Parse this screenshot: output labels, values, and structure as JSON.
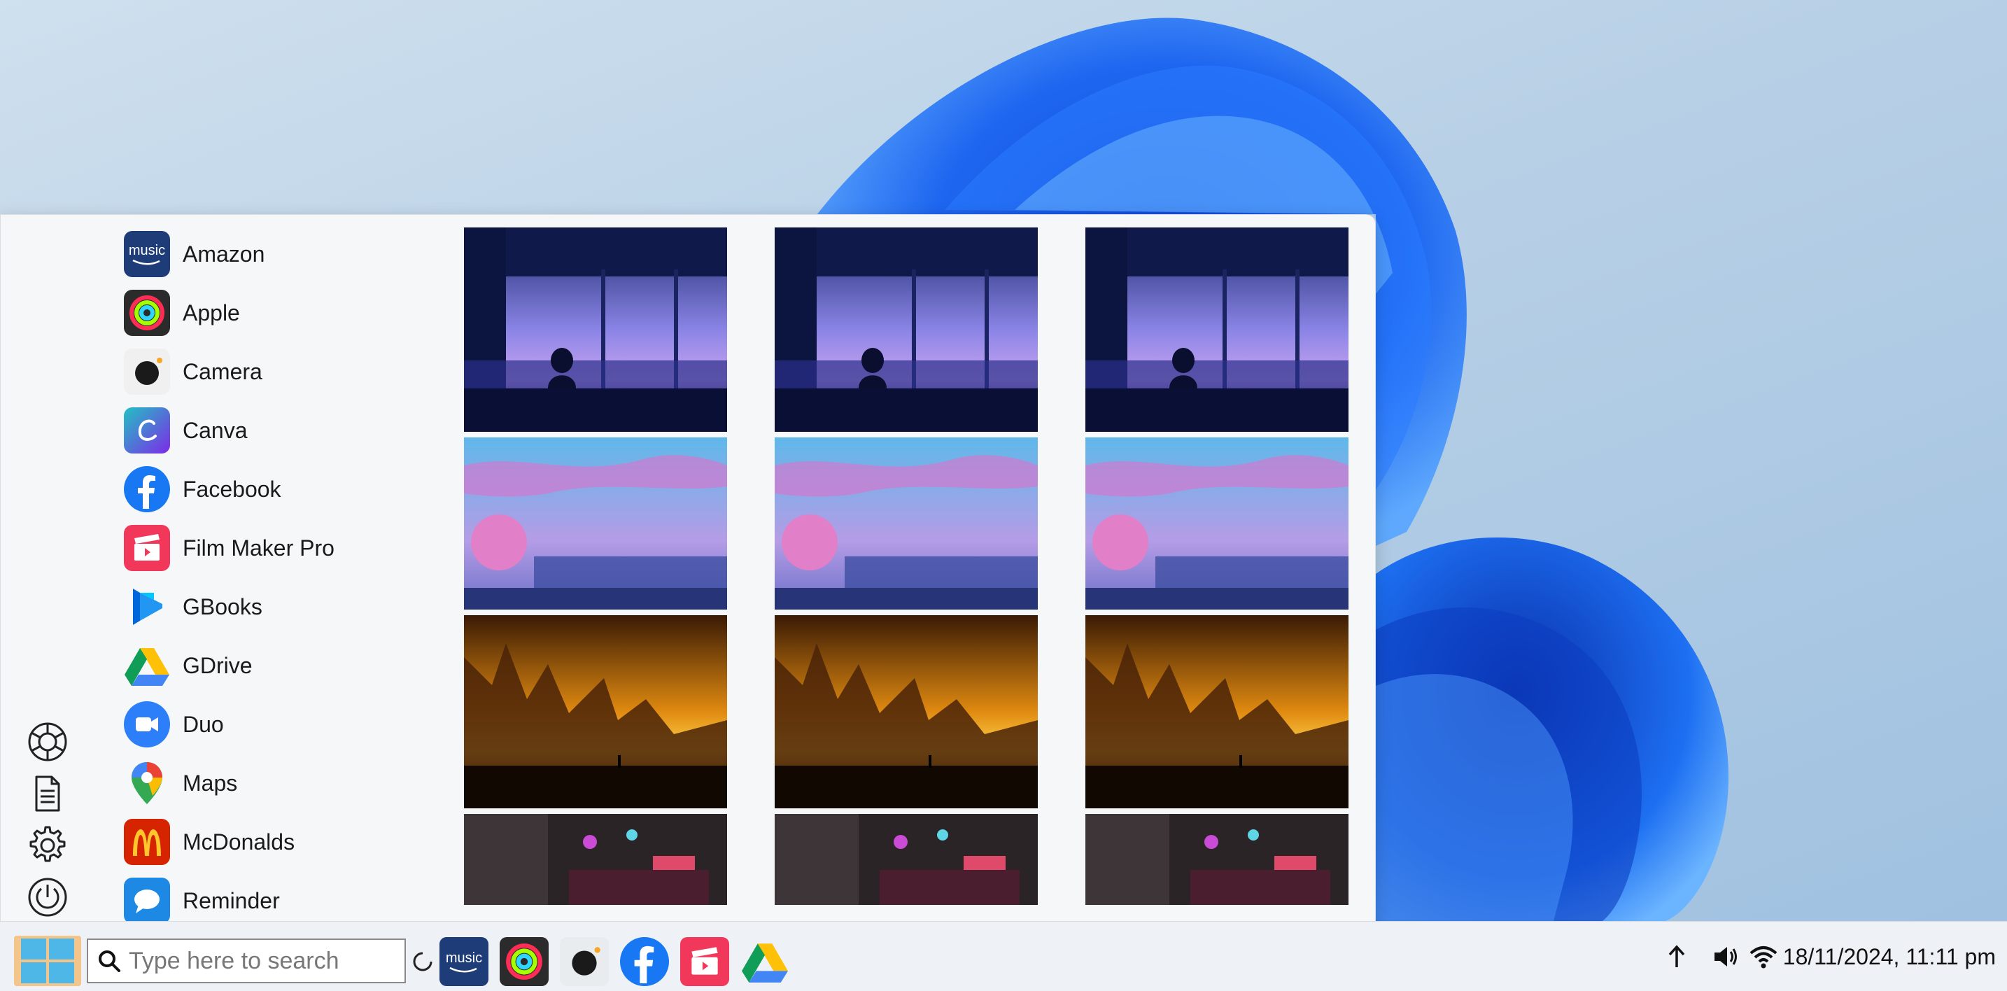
{
  "apps": [
    {
      "label": "Amazon",
      "icon": "amazon-music-icon"
    },
    {
      "label": "Apple",
      "icon": "apple-activity-icon"
    },
    {
      "label": "Camera",
      "icon": "camera-icon"
    },
    {
      "label": "Canva",
      "icon": "canva-icon"
    },
    {
      "label": "Facebook",
      "icon": "facebook-icon"
    },
    {
      "label": "Film Maker Pro",
      "icon": "film-maker-icon"
    },
    {
      "label": "GBooks",
      "icon": "google-books-icon"
    },
    {
      "label": "GDrive",
      "icon": "google-drive-icon"
    },
    {
      "label": "Duo",
      "icon": "duo-video-icon"
    },
    {
      "label": "Maps",
      "icon": "maps-pin-icon"
    },
    {
      "label": "McDonalds",
      "icon": "mcdonalds-icon"
    },
    {
      "label": "Reminder",
      "icon": "reminder-chat-icon"
    }
  ],
  "amazon_icon_text": "music",
  "side_rail": [
    "help-ring-icon",
    "document-icon",
    "settings-gear-icon",
    "power-icon"
  ],
  "gallery_tiles": [
    "night-window-scene",
    "cherry-blossom-city",
    "sunset-canyon",
    "neon-street"
  ],
  "search": {
    "placeholder": "Type here to search"
  },
  "taskbar_apps": [
    "amazon-music-icon",
    "apple-activity-icon",
    "camera-icon",
    "facebook-icon",
    "film-maker-icon",
    "google-drive-icon"
  ],
  "clock": "18/11/2024, 11:11 pm",
  "colors": {
    "accent": "#0a58ff",
    "start_button": "#f3c58a",
    "win_logo": "#4fb6e8"
  }
}
